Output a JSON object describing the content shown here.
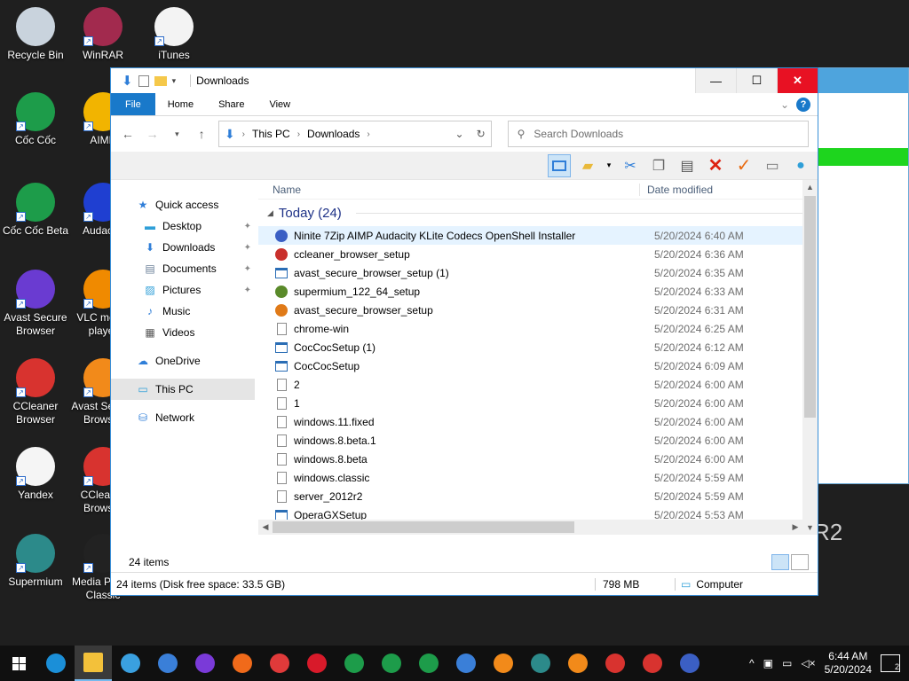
{
  "desktop": {
    "icons": [
      {
        "label": "Recycle Bin",
        "color": "#c9d3dd"
      },
      {
        "label": "WinRAR",
        "color": "#a22a4e"
      },
      {
        "label": "iTunes",
        "color": "#f3f3f3"
      },
      {
        "label": "Cốc Cốc",
        "color": "#1d9c4a"
      },
      {
        "label": "AIMP",
        "color": "#f2b400"
      },
      {
        "label": "Cốc Cốc Beta",
        "color": "#1d9c4a"
      },
      {
        "label": "Audacity",
        "color": "#1f3fd1"
      },
      {
        "label": "Avast Secure Browser",
        "color": "#6a3bd1"
      },
      {
        "label": "VLC media player",
        "color": "#f08a00"
      },
      {
        "label": "CCleaner Browser",
        "color": "#d8332f"
      },
      {
        "label": "Avast Secure Browser",
        "color": "#f28a1a"
      },
      {
        "label": "Yandex",
        "color": "#f5f5f5"
      },
      {
        "label": "CCleaner Browser",
        "color": "#d8332f"
      },
      {
        "label": "Supermium",
        "color": "#2c8a8a"
      },
      {
        "label": "Media Player Classic",
        "color": "#222222"
      }
    ],
    "partial_text": "R2"
  },
  "window": {
    "title": "Downloads",
    "controls": {
      "minimize": "—",
      "maximize": "☐",
      "close": "✕"
    }
  },
  "ribbon": {
    "tabs": [
      "File",
      "Home",
      "Share",
      "View"
    ],
    "help": "?"
  },
  "address": {
    "crumbs": [
      "This PC",
      "Downloads"
    ],
    "search_placeholder": "Search Downloads"
  },
  "nav": {
    "quick_access": "Quick access",
    "pinned": [
      "Desktop",
      "Downloads",
      "Documents",
      "Pictures"
    ],
    "unpinned": [
      "Music",
      "Videos"
    ],
    "onedrive": "OneDrive",
    "this_pc": "This PC",
    "network": "Network"
  },
  "columns": {
    "name": "Name",
    "date": "Date modified"
  },
  "group": {
    "label": "Today (24)"
  },
  "files": [
    {
      "name": "Ninite 7Zip AIMP Audacity KLite Codecs OpenShell Installer",
      "date": "5/20/2024 6:40 AM",
      "icon": "ninite",
      "color": "#3b5fc4"
    },
    {
      "name": "ccleaner_browser_setup",
      "date": "5/20/2024 6:36 AM",
      "icon": "round",
      "color": "#c9302c"
    },
    {
      "name": "avast_secure_browser_setup (1)",
      "date": "5/20/2024 6:35 AM",
      "icon": "exe",
      "color": "#2a6db5"
    },
    {
      "name": "supermium_122_64_setup",
      "date": "5/20/2024 6:33 AM",
      "icon": "round",
      "color": "#5a8a2a"
    },
    {
      "name": "avast_secure_browser_setup",
      "date": "5/20/2024 6:31 AM",
      "icon": "round",
      "color": "#e07a18"
    },
    {
      "name": "chrome-win",
      "date": "5/20/2024 6:25 AM",
      "icon": "doc",
      "color": "#8c8c8c"
    },
    {
      "name": "CocCocSetup (1)",
      "date": "5/20/2024 6:12 AM",
      "icon": "exe",
      "color": "#2a6db5"
    },
    {
      "name": "CocCocSetup",
      "date": "5/20/2024 6:09 AM",
      "icon": "exe",
      "color": "#2a6db5"
    },
    {
      "name": "2",
      "date": "5/20/2024 6:00 AM",
      "icon": "doc",
      "color": "#8c8c8c"
    },
    {
      "name": "1",
      "date": "5/20/2024 6:00 AM",
      "icon": "doc",
      "color": "#8c8c8c"
    },
    {
      "name": "windows.11.fixed",
      "date": "5/20/2024 6:00 AM",
      "icon": "doc",
      "color": "#8c8c8c"
    },
    {
      "name": "windows.8.beta.1",
      "date": "5/20/2024 6:00 AM",
      "icon": "doc",
      "color": "#8c8c8c"
    },
    {
      "name": "windows.8.beta",
      "date": "5/20/2024 6:00 AM",
      "icon": "doc",
      "color": "#8c8c8c"
    },
    {
      "name": "windows.classic",
      "date": "5/20/2024 5:59 AM",
      "icon": "doc",
      "color": "#8c8c8c"
    },
    {
      "name": "server_2012r2",
      "date": "5/20/2024 5:59 AM",
      "icon": "doc",
      "color": "#8c8c8c"
    },
    {
      "name": "OperaGXSetup",
      "date": "5/20/2024 5:53 AM",
      "icon": "exe",
      "color": "#2a6db5"
    }
  ],
  "status": {
    "items_count": "24 items",
    "summary": "24 items (Disk free space: 33.5 GB)",
    "size": "798 MB",
    "location": "Computer"
  },
  "taskbar": {
    "apps": [
      {
        "name": "edge",
        "color": "#1b8fd8"
      },
      {
        "name": "explorer",
        "color": "#f3c13a"
      },
      {
        "name": "store",
        "color": "#3aa0e0"
      },
      {
        "name": "mail",
        "color": "#3a7fd8"
      },
      {
        "name": "firefox",
        "color": "#7a3ad8"
      },
      {
        "name": "brave",
        "color": "#f06a1a"
      },
      {
        "name": "vivaldi",
        "color": "#e03a3a"
      },
      {
        "name": "opera",
        "color": "#d81a2a"
      },
      {
        "name": "coccoc-can",
        "color": "#1d9c4a"
      },
      {
        "name": "coccoc",
        "color": "#1d9c4a"
      },
      {
        "name": "coccoc-beta",
        "color": "#1d9c4a"
      },
      {
        "name": "chromium",
        "color": "#3a7fd8"
      },
      {
        "name": "avast",
        "color": "#f28a1a"
      },
      {
        "name": "supermium",
        "color": "#2c8a8a"
      },
      {
        "name": "avast-2",
        "color": "#f28a1a"
      },
      {
        "name": "ccleaner",
        "color": "#d8332f"
      },
      {
        "name": "ccleaner-2",
        "color": "#d8332f"
      },
      {
        "name": "ninite",
        "color": "#3b5fc4"
      }
    ],
    "time": "6:44 AM",
    "date": "5/20/2024",
    "notifications": "2"
  }
}
